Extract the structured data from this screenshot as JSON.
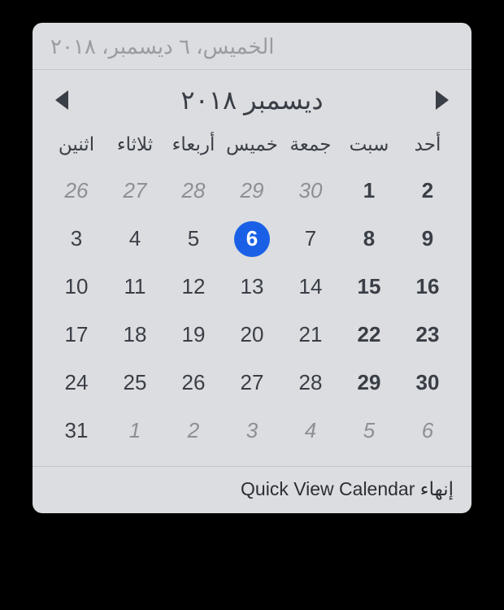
{
  "header": {
    "full_date": "الخميس، ٦ ديسمبر، ٢٠١٨"
  },
  "nav": {
    "month_year": "ديسمبر ٢٠١٨"
  },
  "weekdays": [
    "اثنين",
    "ثلاثاء",
    "أربعاء",
    "خميس",
    "جمعة",
    "سبت",
    "أحد"
  ],
  "weeks": [
    [
      {
        "d": "26",
        "other": true
      },
      {
        "d": "27",
        "other": true
      },
      {
        "d": "28",
        "other": true
      },
      {
        "d": "29",
        "other": true
      },
      {
        "d": "30",
        "other": true
      },
      {
        "d": "1",
        "weekend": true
      },
      {
        "d": "2",
        "weekend": true
      }
    ],
    [
      {
        "d": "3"
      },
      {
        "d": "4"
      },
      {
        "d": "5"
      },
      {
        "d": "6",
        "today": true
      },
      {
        "d": "7"
      },
      {
        "d": "8",
        "weekend": true
      },
      {
        "d": "9",
        "weekend": true
      }
    ],
    [
      {
        "d": "10"
      },
      {
        "d": "11"
      },
      {
        "d": "12"
      },
      {
        "d": "13"
      },
      {
        "d": "14"
      },
      {
        "d": "15",
        "weekend": true
      },
      {
        "d": "16",
        "weekend": true
      }
    ],
    [
      {
        "d": "17"
      },
      {
        "d": "18"
      },
      {
        "d": "19"
      },
      {
        "d": "20"
      },
      {
        "d": "21"
      },
      {
        "d": "22",
        "weekend": true
      },
      {
        "d": "23",
        "weekend": true
      }
    ],
    [
      {
        "d": "24"
      },
      {
        "d": "25"
      },
      {
        "d": "26"
      },
      {
        "d": "27"
      },
      {
        "d": "28"
      },
      {
        "d": "29",
        "weekend": true
      },
      {
        "d": "30",
        "weekend": true
      }
    ],
    [
      {
        "d": "31"
      },
      {
        "d": "1",
        "other": true
      },
      {
        "d": "2",
        "other": true
      },
      {
        "d": "3",
        "other": true
      },
      {
        "d": "4",
        "other": true
      },
      {
        "d": "5",
        "other": true
      },
      {
        "d": "6",
        "other": true
      }
    ]
  ],
  "footer": {
    "quit_label": "إنهاء Quick View Calendar"
  },
  "colors": {
    "accent": "#1a60e6",
    "background": "#dbdde0",
    "text": "#3a3e46",
    "muted": "#9a9ca0"
  }
}
